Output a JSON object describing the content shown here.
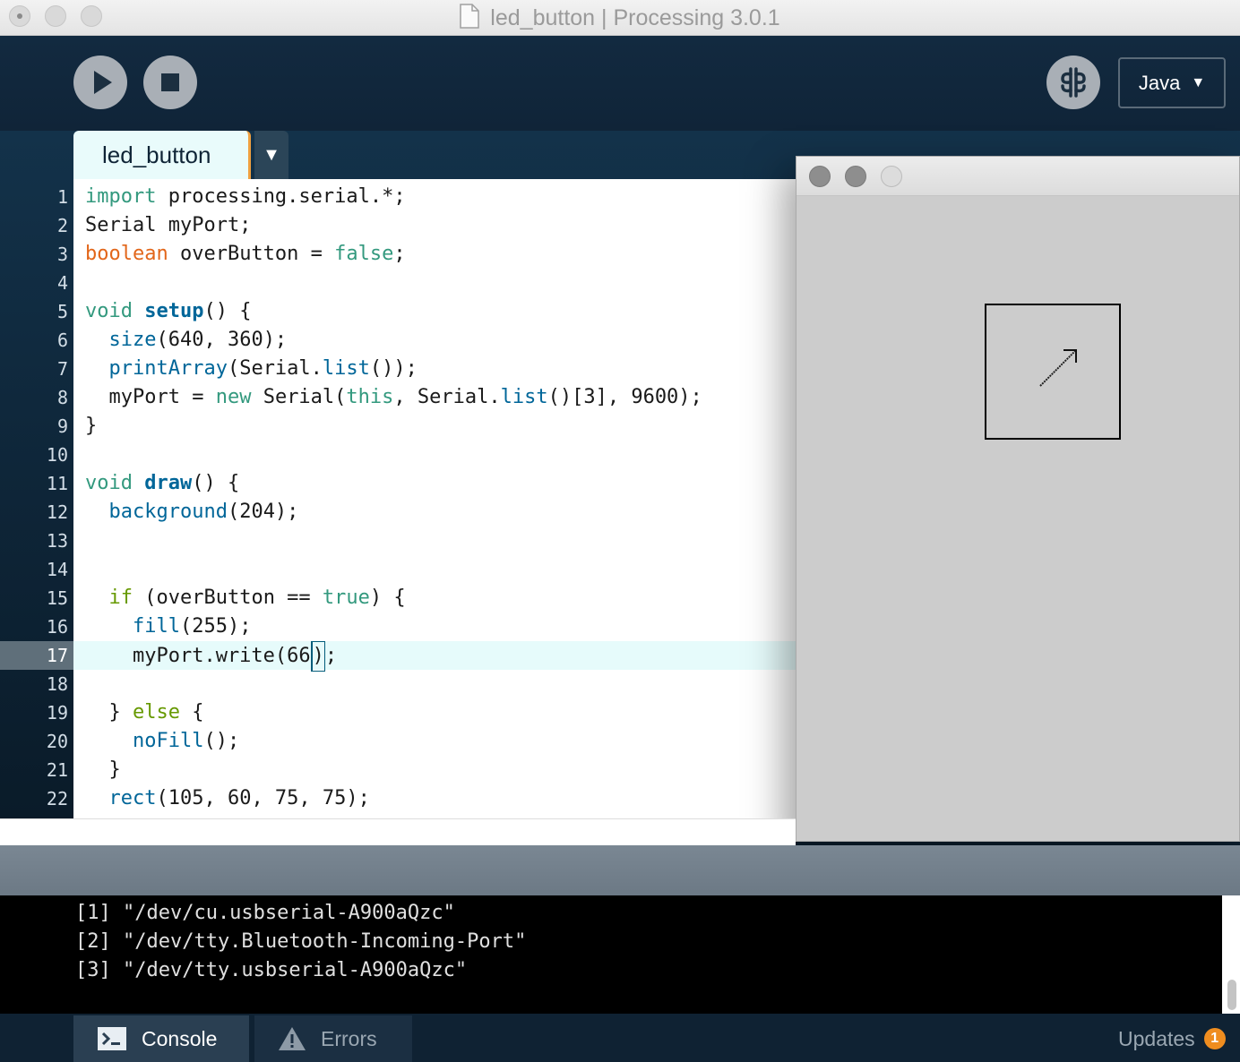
{
  "window": {
    "title": "led_button | Processing 3.0.1"
  },
  "toolbar": {
    "mode_label": "Java",
    "mode_arrow": "▼"
  },
  "editor": {
    "tab_label": "led_button",
    "tab_menu_arrow": "▼",
    "current_line": 17,
    "line_numbers": [
      "1",
      "2",
      "3",
      "4",
      "5",
      "6",
      "7",
      "8",
      "9",
      "10",
      "11",
      "12",
      "13",
      "14",
      "15",
      "16",
      "17",
      "18",
      "19",
      "20",
      "21",
      "22"
    ],
    "lines": [
      [
        {
          "t": "import",
          "c": "kw"
        },
        {
          "t": " processing.serial.*;",
          "c": ""
        }
      ],
      [
        {
          "t": "Serial myPort;",
          "c": ""
        }
      ],
      [
        {
          "t": "boolean",
          "c": "ty"
        },
        {
          "t": " overButton = ",
          "c": ""
        },
        {
          "t": "false",
          "c": "kw"
        },
        {
          "t": ";",
          "c": ""
        }
      ],
      [],
      [
        {
          "t": "void",
          "c": "kw"
        },
        {
          "t": " ",
          "c": ""
        },
        {
          "t": "setup",
          "c": "fn"
        },
        {
          "t": "() {",
          "c": ""
        }
      ],
      [
        {
          "t": "  ",
          "c": ""
        },
        {
          "t": "size",
          "c": "api"
        },
        {
          "t": "(640, 360);",
          "c": ""
        }
      ],
      [
        {
          "t": "  ",
          "c": ""
        },
        {
          "t": "printArray",
          "c": "api"
        },
        {
          "t": "(Serial.",
          "c": ""
        },
        {
          "t": "list",
          "c": "api"
        },
        {
          "t": "());",
          "c": ""
        }
      ],
      [
        {
          "t": "  myPort = ",
          "c": ""
        },
        {
          "t": "new",
          "c": "kw"
        },
        {
          "t": " Serial(",
          "c": ""
        },
        {
          "t": "this",
          "c": "kw"
        },
        {
          "t": ", Serial.",
          "c": ""
        },
        {
          "t": "list",
          "c": "api"
        },
        {
          "t": "()[3], 9600);",
          "c": ""
        }
      ],
      [
        {
          "t": "}",
          "c": ""
        }
      ],
      [],
      [
        {
          "t": "void",
          "c": "kw"
        },
        {
          "t": " ",
          "c": ""
        },
        {
          "t": "draw",
          "c": "fn"
        },
        {
          "t": "() {",
          "c": ""
        }
      ],
      [
        {
          "t": "  ",
          "c": ""
        },
        {
          "t": "background",
          "c": "api"
        },
        {
          "t": "(204);",
          "c": ""
        }
      ],
      [],
      [],
      [
        {
          "t": "  ",
          "c": ""
        },
        {
          "t": "if",
          "c": "ctl"
        },
        {
          "t": " (overButton == ",
          "c": ""
        },
        {
          "t": "true",
          "c": "kw"
        },
        {
          "t": ") {",
          "c": ""
        }
      ],
      [
        {
          "t": "    ",
          "c": ""
        },
        {
          "t": "fill",
          "c": "api"
        },
        {
          "t": "(255);",
          "c": ""
        }
      ],
      [
        {
          "t": "    myPort.write(66",
          "c": ""
        },
        {
          "t": ")",
          "c": "caret"
        },
        {
          "t": ";",
          "c": ""
        }
      ],
      [],
      [
        {
          "t": "  } ",
          "c": ""
        },
        {
          "t": "else",
          "c": "ctl"
        },
        {
          "t": " {",
          "c": ""
        }
      ],
      [
        {
          "t": "    ",
          "c": ""
        },
        {
          "t": "noFill",
          "c": "api"
        },
        {
          "t": "();",
          "c": ""
        }
      ],
      [
        {
          "t": "  }",
          "c": ""
        }
      ],
      [
        {
          "t": "  ",
          "c": ""
        },
        {
          "t": "rect",
          "c": "api"
        },
        {
          "t": "(105, 60, 75, 75);",
          "c": ""
        }
      ]
    ]
  },
  "console": {
    "lines": [
      "[1] \"/dev/cu.usbserial-A900aQzc\"",
      "[2] \"/dev/tty.Bluetooth-Incoming-Port\"",
      "[3] \"/dev/tty.usbserial-A900aQzc\""
    ]
  },
  "bottom_bar": {
    "console_label": "Console",
    "errors_label": "Errors",
    "updates_label": "Updates",
    "updates_count": "1"
  },
  "colors": {
    "keyword": "#33997e",
    "type": "#e2661a",
    "function": "#006699",
    "control": "#669900",
    "updates_badge": "#ef8d1f"
  },
  "icons": [
    "run-icon",
    "stop-icon",
    "debug-icon",
    "document-icon",
    "console-icon",
    "warning-icon",
    "cursor-arrow-icon"
  ]
}
